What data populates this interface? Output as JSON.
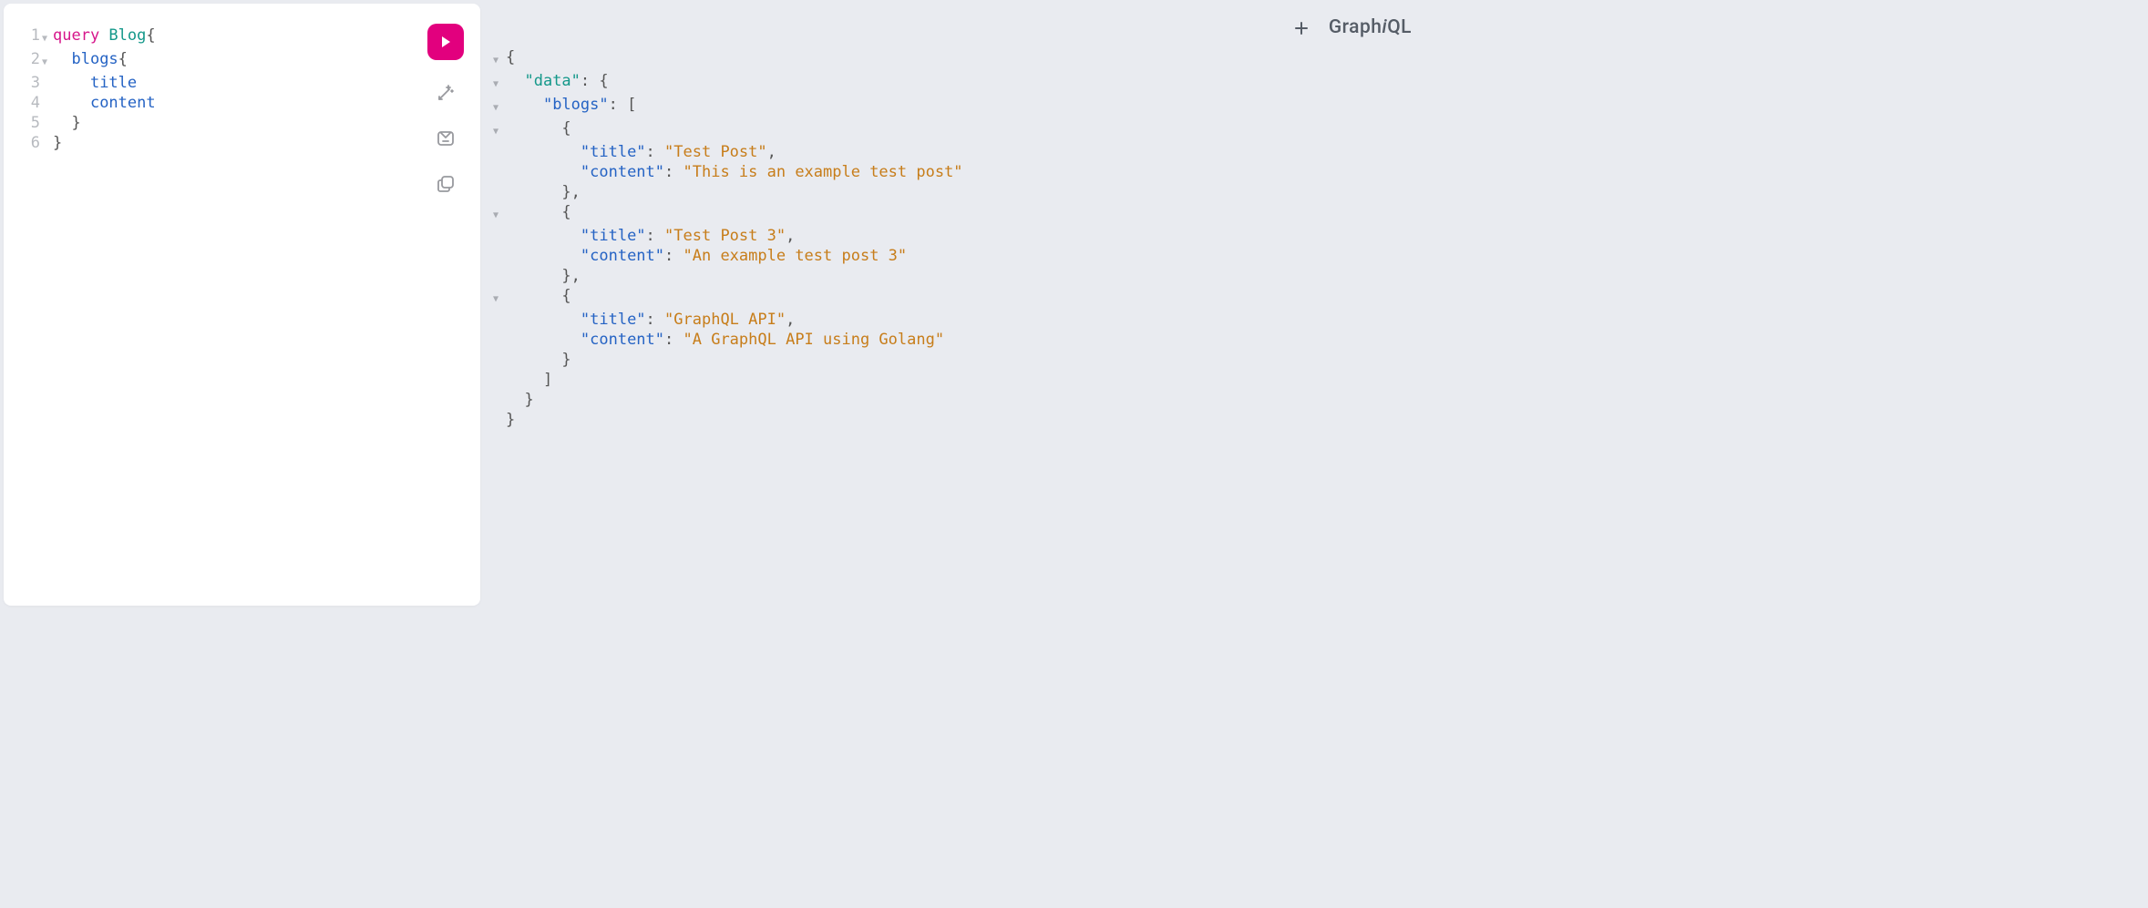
{
  "brand": {
    "pre": "Graph",
    "i": "i",
    "post": "QL"
  },
  "editor": {
    "lines": [
      {
        "num": "1",
        "fold": true,
        "indent": 0,
        "tokens": [
          {
            "t": "query ",
            "c": "tok-keyword"
          },
          {
            "t": "Blog",
            "c": "tok-def"
          },
          {
            "t": "{",
            "c": "tok-brace"
          }
        ]
      },
      {
        "num": "2",
        "fold": true,
        "indent": 2,
        "tokens": [
          {
            "t": "blogs",
            "c": "tok-field"
          },
          {
            "t": "{",
            "c": "tok-brace"
          }
        ]
      },
      {
        "num": "3",
        "fold": false,
        "indent": 4,
        "tokens": [
          {
            "t": "title",
            "c": "tok-field"
          }
        ]
      },
      {
        "num": "4",
        "fold": false,
        "indent": 4,
        "tokens": [
          {
            "t": "content",
            "c": "tok-field"
          }
        ]
      },
      {
        "num": "5",
        "fold": false,
        "indent": 2,
        "tokens": [
          {
            "t": "}",
            "c": "tok-brace"
          }
        ]
      },
      {
        "num": "6",
        "fold": false,
        "indent": 0,
        "tokens": [
          {
            "t": "}",
            "c": "tok-brace"
          }
        ]
      }
    ]
  },
  "response": {
    "lines": [
      {
        "fold": true,
        "indent": 0,
        "tokens": [
          {
            "t": "{",
            "c": "j-punct"
          }
        ]
      },
      {
        "fold": true,
        "indent": 2,
        "tokens": [
          {
            "t": "\"data\"",
            "c": "j-key-prop"
          },
          {
            "t": ": ",
            "c": "j-punct"
          },
          {
            "t": "{",
            "c": "j-punct"
          }
        ]
      },
      {
        "fold": true,
        "indent": 4,
        "tokens": [
          {
            "t": "\"blogs\"",
            "c": "j-key"
          },
          {
            "t": ": ",
            "c": "j-punct"
          },
          {
            "t": "[",
            "c": "j-punct"
          }
        ]
      },
      {
        "fold": true,
        "indent": 6,
        "tokens": [
          {
            "t": "{",
            "c": "j-punct"
          }
        ]
      },
      {
        "fold": false,
        "indent": 8,
        "tokens": [
          {
            "t": "\"title\"",
            "c": "j-key"
          },
          {
            "t": ": ",
            "c": "j-punct"
          },
          {
            "t": "\"Test Post\"",
            "c": "j-string"
          },
          {
            "t": ",",
            "c": "j-punct"
          }
        ]
      },
      {
        "fold": false,
        "indent": 8,
        "tokens": [
          {
            "t": "\"content\"",
            "c": "j-key"
          },
          {
            "t": ": ",
            "c": "j-punct"
          },
          {
            "t": "\"This is an example test post\"",
            "c": "j-string"
          }
        ]
      },
      {
        "fold": false,
        "indent": 6,
        "tokens": [
          {
            "t": "},",
            "c": "j-punct"
          }
        ]
      },
      {
        "fold": true,
        "indent": 6,
        "tokens": [
          {
            "t": "{",
            "c": "j-punct"
          }
        ]
      },
      {
        "fold": false,
        "indent": 8,
        "tokens": [
          {
            "t": "\"title\"",
            "c": "j-key"
          },
          {
            "t": ": ",
            "c": "j-punct"
          },
          {
            "t": "\"Test Post 3\"",
            "c": "j-string"
          },
          {
            "t": ",",
            "c": "j-punct"
          }
        ]
      },
      {
        "fold": false,
        "indent": 8,
        "tokens": [
          {
            "t": "\"content\"",
            "c": "j-key"
          },
          {
            "t": ": ",
            "c": "j-punct"
          },
          {
            "t": "\"An example test post 3\"",
            "c": "j-string"
          }
        ]
      },
      {
        "fold": false,
        "indent": 6,
        "tokens": [
          {
            "t": "},",
            "c": "j-punct"
          }
        ]
      },
      {
        "fold": true,
        "indent": 6,
        "tokens": [
          {
            "t": "{",
            "c": "j-punct"
          }
        ]
      },
      {
        "fold": false,
        "indent": 8,
        "tokens": [
          {
            "t": "\"title\"",
            "c": "j-key"
          },
          {
            "t": ": ",
            "c": "j-punct"
          },
          {
            "t": "\"GraphQL API\"",
            "c": "j-string"
          },
          {
            "t": ",",
            "c": "j-punct"
          }
        ]
      },
      {
        "fold": false,
        "indent": 8,
        "tokens": [
          {
            "t": "\"content\"",
            "c": "j-key"
          },
          {
            "t": ": ",
            "c": "j-punct"
          },
          {
            "t": "\"A GraphQL API using Golang\"",
            "c": "j-string"
          }
        ]
      },
      {
        "fold": false,
        "indent": 6,
        "tokens": [
          {
            "t": "}",
            "c": "j-punct"
          }
        ]
      },
      {
        "fold": false,
        "indent": 4,
        "tokens": [
          {
            "t": "]",
            "c": "j-punct"
          }
        ]
      },
      {
        "fold": false,
        "indent": 2,
        "tokens": [
          {
            "t": "}",
            "c": "j-punct"
          }
        ]
      },
      {
        "fold": false,
        "indent": 0,
        "tokens": [
          {
            "t": "}",
            "c": "j-punct"
          }
        ]
      }
    ]
  }
}
